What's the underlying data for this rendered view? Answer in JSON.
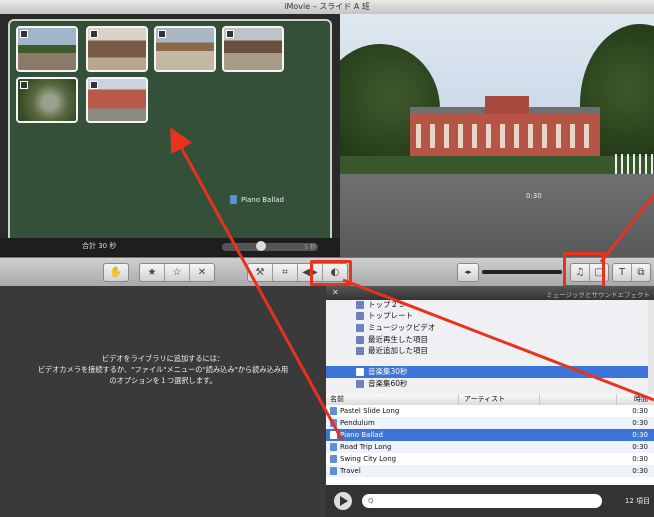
{
  "window": {
    "title": "iMovie – スライド A 班"
  },
  "project": {
    "clips": [
      {
        "thumb": "linear-gradient(#9fb6c8 40%,#3c5a2a 40% 60%,#8a7a6a 60%)"
      },
      {
        "thumb": "linear-gradient(#d8d2c8 30%,#7a5a44 30% 70%,#b8a890 70%)"
      },
      {
        "thumb": "linear-gradient(#a9b8c4 35%,#8a6a4a 35% 55%,#c4b8a4 55%)"
      },
      {
        "thumb": "linear-gradient(#c0c4c8 30%,#6a5040 30% 60%,#a89c88 60%)"
      },
      {
        "thumb": "radial-gradient(circle at 55% 55%,#9aa08a 18%,#58683e 45%,#324a24 80%)"
      },
      {
        "thumb": "linear-gradient(#c8d4e0 25%,#b85a48 25% 70%,#8a8a80 70%)"
      }
    ],
    "music_label": "Piano Ballad",
    "total": "合計 30 秒",
    "zoom": "5 秒"
  },
  "viewer": {
    "time": "0:30"
  },
  "toolbar": {
    "hand": "✋",
    "star_full": "★",
    "star_empty": "☆",
    "reject": "✕",
    "wand": "⚒",
    "crop": "⌗",
    "audio": "◀▶",
    "color": "◐",
    "volume_icon": "◂▸",
    "music_btn": "♫",
    "photo_btn": "▢",
    "title_btn": "T",
    "transition_btn": "⧉"
  },
  "event": {
    "info_line1": "ビデオをライブラリに追加するには：",
    "info_line2": "ビデオカメラを接続するか、\"ファイル\"メニューの\"読み込み\"から読み込み用",
    "info_line3": "のオプションを１つ選択します。"
  },
  "music": {
    "header_close": "✕",
    "header_title": "ミュージックとサウンドエフェクト",
    "sources": [
      "トップ２５",
      "トップレート",
      "ミュージックビデオ",
      "最近再生した項目",
      "最近追加した項目",
      "音楽集30秒",
      "音楽集60秒"
    ],
    "col_name": "名前",
    "col_artist": "アーティスト",
    "col_time": "時間",
    "tracks": [
      {
        "name": "Pastel Slide Long",
        "time": "0:30"
      },
      {
        "name": "Pendulum",
        "time": "0:30"
      },
      {
        "name": "Piano Ballad",
        "time": "0:30"
      },
      {
        "name": "Road Trip Long",
        "time": "0:30"
      },
      {
        "name": "Swing City Long",
        "time": "0:30"
      },
      {
        "name": "Travel",
        "time": "0:30"
      }
    ],
    "search_icon": "Q",
    "item_count": "12 項目"
  }
}
